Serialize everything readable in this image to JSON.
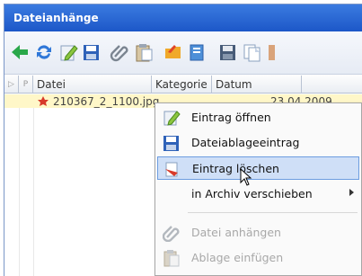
{
  "window": {
    "title": "Dateianhänge"
  },
  "toolbar": {
    "buttons": [
      {
        "icon": "back-arrow-icon"
      },
      {
        "icon": "refresh-icon"
      },
      {
        "icon": "edit-icon"
      },
      {
        "icon": "save-blue-icon"
      },
      {
        "icon": "attach-icon"
      },
      {
        "icon": "clipboard-icon"
      },
      {
        "icon": "folder-icon"
      },
      {
        "icon": "export-icon"
      },
      {
        "icon": "disk-icon"
      },
      {
        "icon": "copy-icon"
      }
    ]
  },
  "grid": {
    "columns": {
      "col1": "▷",
      "col2": "P",
      "file": "Datei",
      "category": "Kategorie",
      "date": "Datum"
    },
    "rows": [
      {
        "file": "210367_2_1100.jpg",
        "category": "",
        "date": "23.04.2009"
      }
    ]
  },
  "context_menu": {
    "items": [
      {
        "label": "Eintrag öffnen",
        "icon": "edit-pencil-icon",
        "enabled": true
      },
      {
        "label": "Dateiablageeintrag",
        "icon": "save-disk-icon",
        "enabled": true
      },
      {
        "label": "Eintrag löschen",
        "icon": "delete-icon",
        "enabled": true,
        "hovered": true
      },
      {
        "label": "in Archiv verschieben",
        "icon": "",
        "enabled": true,
        "submenu": true
      },
      {
        "label": "Datei anhängen",
        "icon": "paperclip-icon",
        "enabled": false
      },
      {
        "label": "Ablage einfügen",
        "icon": "paste-icon",
        "enabled": false
      }
    ]
  },
  "colors": {
    "title_bar": "#1c57c8",
    "row_highlight": "#fff7c8",
    "menu_hover": "#cfdff7"
  }
}
